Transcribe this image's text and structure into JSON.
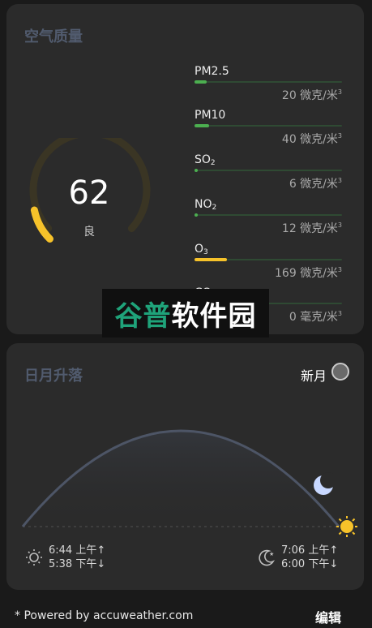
{
  "air_quality": {
    "title": "空气质量",
    "aqi": "62",
    "aqi_level": "良",
    "aqi_fraction": 0.124,
    "pollutants": [
      {
        "name": "PM2.5",
        "name_base": "PM2.5",
        "sub": "",
        "value": "20 微克/米",
        "unit_sup": "3",
        "fraction": 0.08,
        "color": "#4caf50"
      },
      {
        "name": "PM10",
        "name_base": "PM10",
        "sub": "",
        "value": "40 微克/米",
        "unit_sup": "3",
        "fraction": 0.1,
        "color": "#4caf50"
      },
      {
        "name": "SO2",
        "name_base": "SO",
        "sub": "2",
        "value": "6 微克/米",
        "unit_sup": "3",
        "fraction": 0.02,
        "color": "#4caf50"
      },
      {
        "name": "NO2",
        "name_base": "NO",
        "sub": "2",
        "value": "12 微克/米",
        "unit_sup": "3",
        "fraction": 0.02,
        "color": "#4caf50"
      },
      {
        "name": "O3",
        "name_base": "O",
        "sub": "3",
        "value": "169 微克/米",
        "unit_sup": "3",
        "fraction": 0.22,
        "color": "#f6c22a"
      },
      {
        "name": "CO",
        "name_base": "CO",
        "sub": "",
        "value": "0 毫克/米",
        "unit_sup": "3",
        "fraction": 0.0,
        "color": "#4caf50"
      }
    ]
  },
  "watermark": {
    "green": "谷普",
    "white": "软件园"
  },
  "sun_moon": {
    "title": "日月升落",
    "moon_phase": "新月",
    "sunrise": "6:44 上午↑",
    "sunset": "5:38 下午↓",
    "moonrise": "7:06 上午↑",
    "moonset": "6:00 下午↓"
  },
  "footer": {
    "powered_by": "* Powered by accuweather.com",
    "edit": "编辑"
  },
  "colors": {
    "card": "#2b2b2b",
    "background": "#1a1a1a",
    "title": "#515b6e",
    "gauge_fill": "#f6c22a",
    "gauge_track": "#3a3524",
    "sun": "#f6c22a",
    "moon": "#c8d8ff",
    "arc": "#4d5566"
  }
}
